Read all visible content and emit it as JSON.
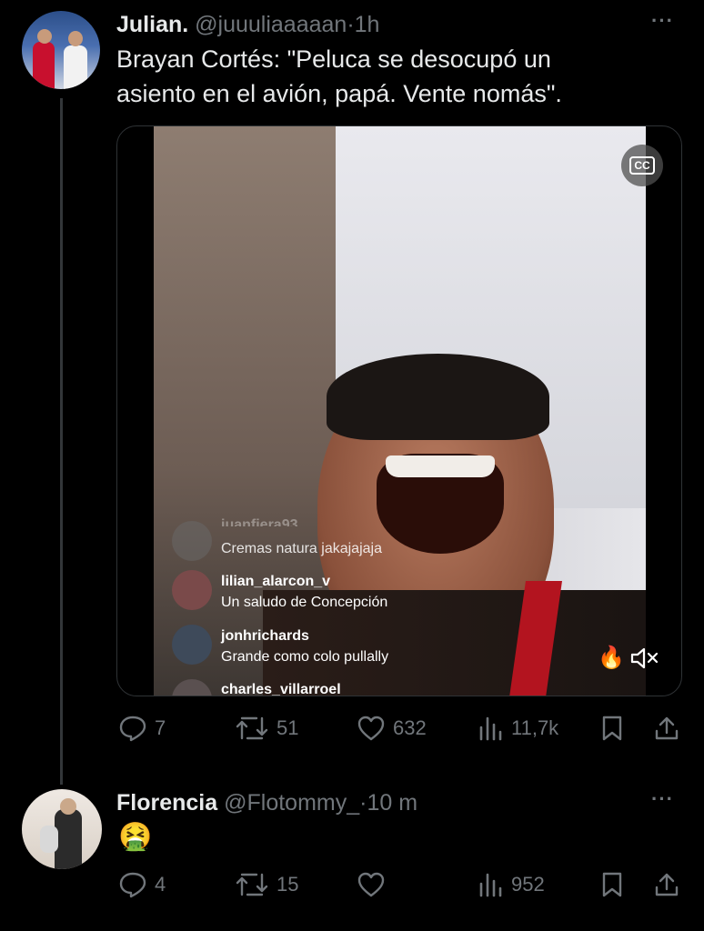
{
  "tweet1": {
    "display_name": "Julian.",
    "handle": "@juuuliaaaaan",
    "separator": "·",
    "time": "1h",
    "text_line1": "Brayan Cortés: \"Peluca se desocupó un",
    "text_line2": "asiento en el avión, papá. Vente nomás\".",
    "more": "···",
    "media": {
      "captions_badge": "CC",
      "comments": [
        {
          "user": "juanfiera93",
          "text": "Cremas natura jakajajaja"
        },
        {
          "user": "lilian_alarcon_v",
          "text": "Un  saludo de  Concepción"
        },
        {
          "user": "jonhrichards",
          "text": "Grande como colo  pullally"
        },
        {
          "user": "charles_villarroel",
          "text": ""
        }
      ],
      "mute_icon": "speaker-muted-icon"
    },
    "actions": {
      "replies": "7",
      "reposts": "51",
      "likes": "632",
      "views": "11,7k"
    }
  },
  "tweet2": {
    "display_name": "Florencia",
    "handle": "@Flotommy_",
    "separator": "·",
    "time": "10 m",
    "emoji": "🤮",
    "more": "···",
    "actions": {
      "replies": "4",
      "reposts": "15",
      "likes": "",
      "views": "952"
    }
  },
  "colors": {
    "background": "#000000",
    "text": "#e7e9ea",
    "secondary": "#71767b",
    "line": "#333639"
  }
}
